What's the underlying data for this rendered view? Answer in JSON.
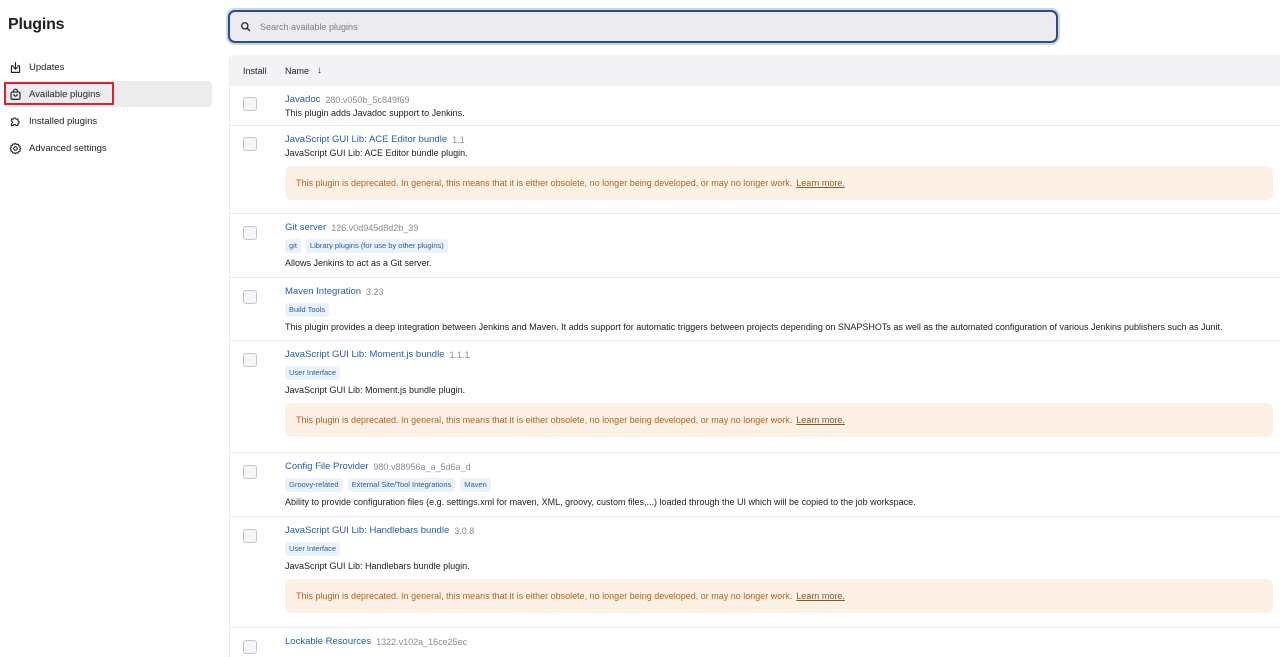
{
  "page_title": "Plugins",
  "nav": {
    "items": [
      {
        "label": "Updates",
        "icon": "download-icon"
      },
      {
        "label": "Available plugins",
        "icon": "shopping-bag-icon"
      },
      {
        "label": "Installed plugins",
        "icon": "puzzle-icon"
      },
      {
        "label": "Advanced settings",
        "icon": "gear-icon"
      }
    ]
  },
  "search": {
    "placeholder": "Search available plugins",
    "value": ""
  },
  "table": {
    "headers": {
      "install": "Install",
      "name": "Name",
      "sort_arrow": "↓"
    },
    "deprecation_text": "This plugin is deprecated. In general, this means that it is either obsolete, no longer being developed, or may no longer work.",
    "learn_more": "Learn more.",
    "rows": [
      {
        "name": "Javadoc",
        "version": "280.v050b_5c849f69",
        "tags": [],
        "description": "This plugin adds Javadoc support to Jenkins.",
        "deprecated": false
      },
      {
        "name": "JavaScript GUI Lib: ACE Editor bundle",
        "version": "1.1",
        "tags": [],
        "description": "JavaScript GUI Lib: ACE Editor bundle plugin.",
        "deprecated": true
      },
      {
        "name": "Git server",
        "version": "126.v0d945d8d2b_39",
        "tags": [
          "git",
          "Library plugins (for use by other plugins)"
        ],
        "description": "Allows Jenkins to act as a Git server.",
        "deprecated": false
      },
      {
        "name": "Maven Integration",
        "version": "3.23",
        "tags": [
          "Build Tools"
        ],
        "description": "This plugin provides a deep integration between Jenkins and Maven. It adds support for automatic triggers between projects depending on SNAPSHOTs as well as the automated configuration of various Jenkins publishers such as Junit.",
        "deprecated": false
      },
      {
        "name": "JavaScript GUI Lib: Moment.js bundle",
        "version": "1.1.1",
        "tags": [
          "User Interface"
        ],
        "description": "JavaScript GUI Lib: Moment.js bundle plugin.",
        "deprecated": true
      },
      {
        "name": "Config File Provider",
        "version": "980.v88956a_a_5d6a_d",
        "tags": [
          "Groovy-related",
          "External Site/Tool Integrations",
          "Maven"
        ],
        "description": "Ability to provide configuration files (e.g. settings.xml for maven, XML, groovy, custom files,...) loaded through the UI which will be copied to the job workspace.",
        "deprecated": false
      },
      {
        "name": "JavaScript GUI Lib: Handlebars bundle",
        "version": "3.0.8",
        "tags": [
          "User Interface"
        ],
        "description": "JavaScript GUI Lib: Handlebars bundle plugin.",
        "deprecated": true
      },
      {
        "name": "Lockable Resources",
        "version": "1322.v102a_16ce25ec",
        "tags": [],
        "description": "",
        "deprecated": false
      }
    ]
  }
}
